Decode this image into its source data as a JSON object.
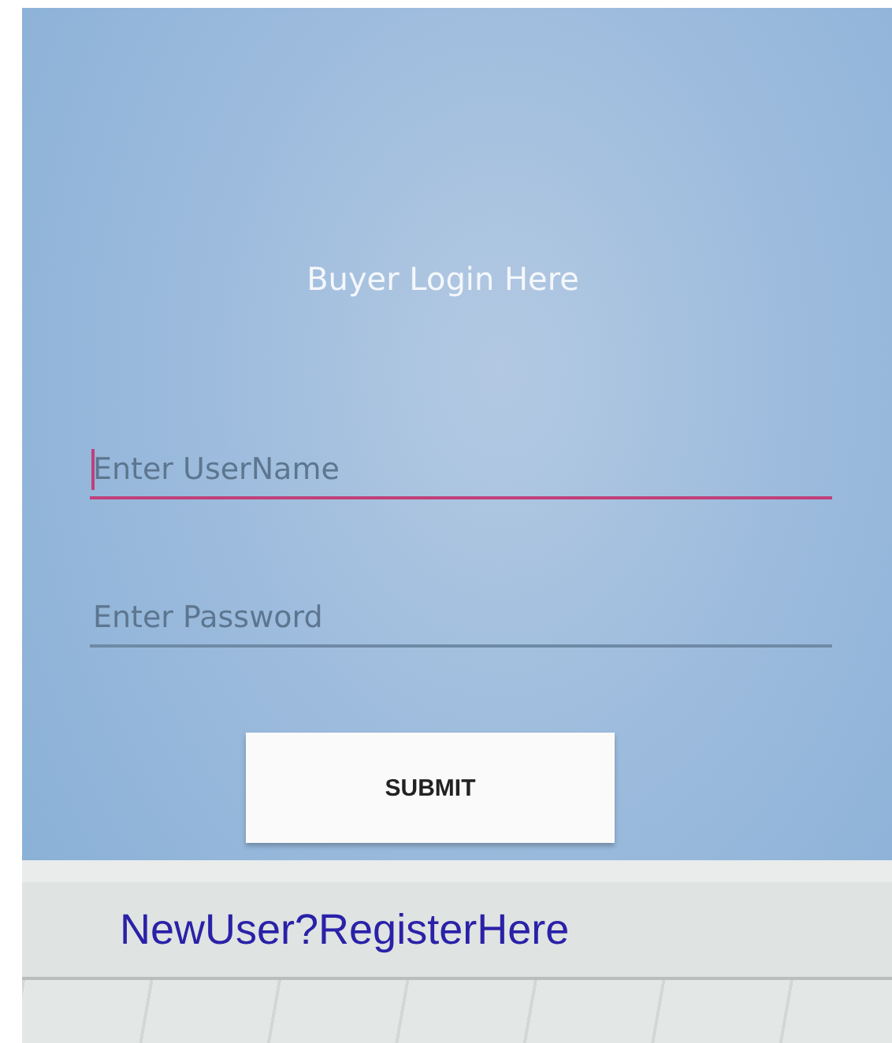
{
  "title": "Buyer Login Here",
  "fields": [
    {
      "placeholder": "Enter UserName",
      "focused": true
    },
    {
      "placeholder": "Enter Password",
      "focused": false
    }
  ],
  "submit_button": "SUBMIT",
  "register_link": "NewUser?RegisterHere"
}
